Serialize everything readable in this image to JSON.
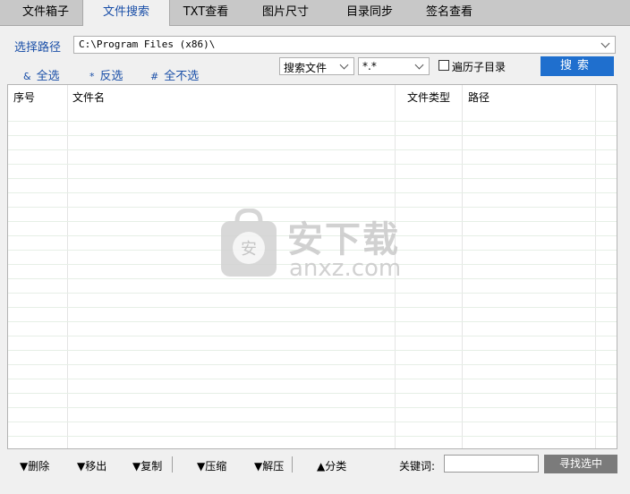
{
  "tabs": [
    "文件箱子",
    "文件搜索",
    "TXT查看",
    "图片尺寸",
    "目录同步",
    "签名查看"
  ],
  "active_tab": "文件搜索",
  "path": {
    "label": "选择路径",
    "value": "C:\\Program Files (x86)\\"
  },
  "selection": [
    {
      "symbol": "&",
      "label": "全选"
    },
    {
      "symbol": "*",
      "label": "反选"
    },
    {
      "symbol": "#",
      "label": "全不选"
    }
  ],
  "search_mode": {
    "selected": "搜索文件"
  },
  "file_filter": {
    "selected": "*.*"
  },
  "subdir_checkbox": {
    "label": "遍历子目录",
    "checked": false
  },
  "search_button": "搜索",
  "table": {
    "columns": [
      "序号",
      "文件名",
      "文件类型",
      "路径"
    ],
    "rows": []
  },
  "watermark": {
    "cn": "安下载",
    "en": "anxz.com"
  },
  "bottom_toolbar": {
    "buttons": [
      "▼删除",
      "▼移出",
      "▼复制",
      "▼压缩",
      "▼解压",
      "▲分类"
    ],
    "keyword_label": "关键词:",
    "keyword_value": "",
    "find_button": "寻找选中"
  },
  "colors": {
    "accent": "#1f6fce",
    "link": "#1a4fa8",
    "find_button": "#7b7b7b"
  }
}
